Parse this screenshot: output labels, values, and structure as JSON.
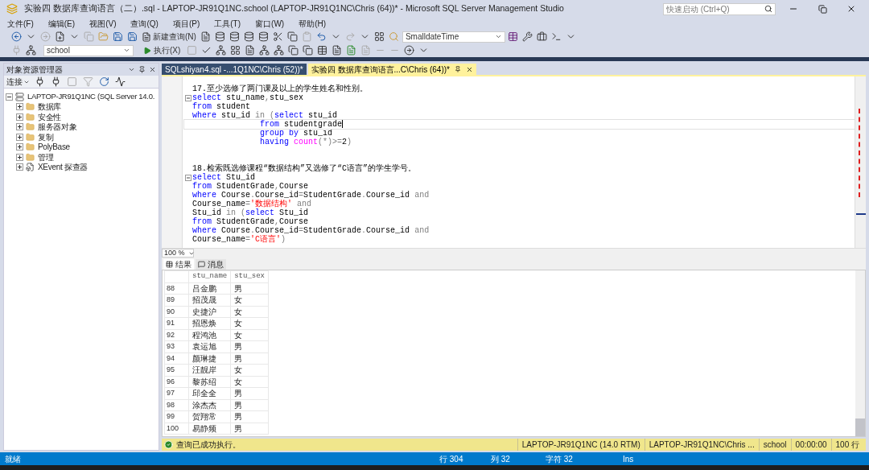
{
  "window": {
    "title": "实验四 数据库查询语言（二）.sql - LAPTOP-JR91Q1NC.school (LAPTOP-JR91Q1NC\\Chris (64))* - Microsoft SQL Server Management Studio",
    "quick_launch": {
      "placeholder": "快速启动 (Ctrl+Q)"
    }
  },
  "menu": [
    "文件(F)",
    "编辑(E)",
    "视图(V)",
    "查询(Q)",
    "项目(P)",
    "工具(T)",
    "窗口(W)",
    "帮助(H)"
  ],
  "toolbar": {
    "new_query": "新建查询(N)",
    "type_dropdown": "SmalldateTime",
    "database_dropdown": "school",
    "execute": "执行(X)"
  },
  "object_explorer": {
    "title": "对象资源管理器",
    "connect": "连接",
    "tree": [
      {
        "label": "LAPTOP-JR91Q1NC (SQL Server 14.0.",
        "kind": "server",
        "expanded": true,
        "children": [
          {
            "label": "数据库",
            "kind": "folder",
            "expanded": false
          },
          {
            "label": "安全性",
            "kind": "folder",
            "expanded": false
          },
          {
            "label": "服务器对象",
            "kind": "folder",
            "expanded": false
          },
          {
            "label": "复制",
            "kind": "folder",
            "expanded": false
          },
          {
            "label": "PolyBase",
            "kind": "folder",
            "expanded": false
          },
          {
            "label": "管理",
            "kind": "folder",
            "expanded": false
          },
          {
            "label": "XEvent 探查器",
            "kind": "xevent",
            "expanded": false
          }
        ]
      }
    ]
  },
  "editor_tabs": [
    {
      "label": "SQLshiyan4.sql -...1Q1NC\\Chris (52))*",
      "selected": false
    },
    {
      "label": "实验四  数据库查询语言...C\\Chris (64))*",
      "selected": true
    }
  ],
  "editor": {
    "zoom": "100 %",
    "lines": [
      {
        "fold": false,
        "current": false,
        "tokens": [
          {
            "t": "17.至少选修了两门课及以上的学生姓名和性别。",
            "kind": "text"
          }
        ]
      },
      {
        "fold": true,
        "current": false,
        "tokens": [
          {
            "t": "select",
            "kind": "kw"
          },
          {
            "t": " stu_name",
            "kind": "id"
          },
          {
            "t": ",",
            "kind": "op"
          },
          {
            "t": "stu_sex",
            "kind": "id"
          }
        ]
      },
      {
        "fold": false,
        "current": false,
        "tokens": [
          {
            "t": "from",
            "kind": "kw"
          },
          {
            "t": " student",
            "kind": "id"
          }
        ]
      },
      {
        "fold": false,
        "current": false,
        "tokens": [
          {
            "t": "where",
            "kind": "kw"
          },
          {
            "t": " stu_id ",
            "kind": "id"
          },
          {
            "t": "in (",
            "kind": "op"
          },
          {
            "t": "select",
            "kind": "kw"
          },
          {
            "t": " stu_id",
            "kind": "id"
          }
        ]
      },
      {
        "fold": false,
        "current": true,
        "tokens": [
          {
            "t": "              from",
            "kind": "kw"
          },
          {
            "t": " studentgrade",
            "kind": "id"
          }
        ]
      },
      {
        "fold": false,
        "current": false,
        "tokens": [
          {
            "t": "              group by",
            "kind": "kw"
          },
          {
            "t": " stu_id",
            "kind": "id"
          }
        ]
      },
      {
        "fold": false,
        "current": false,
        "tokens": [
          {
            "t": "              having",
            "kind": "kw"
          },
          {
            "t": " count",
            "kind": "fn"
          },
          {
            "t": "(*)>=",
            "kind": "op"
          },
          {
            "t": "2",
            "kind": "id"
          },
          {
            "t": ")",
            "kind": "op"
          }
        ]
      },
      {
        "fold": false,
        "current": false
      },
      {
        "fold": false,
        "current": false
      },
      {
        "fold": false,
        "current": false,
        "tokens": [
          {
            "t": "18.检索既选修课程“数据结构”又选修了“C语言”的学生学号。",
            "kind": "text"
          }
        ]
      },
      {
        "fold": true,
        "current": false,
        "tokens": [
          {
            "t": "select",
            "kind": "kw"
          },
          {
            "t": " Stu_id",
            "kind": "id"
          }
        ]
      },
      {
        "fold": false,
        "current": false,
        "tokens": [
          {
            "t": "from",
            "kind": "kw"
          },
          {
            "t": " StudentGrade",
            "kind": "id"
          },
          {
            "t": ",",
            "kind": "op"
          },
          {
            "t": "Course",
            "kind": "id"
          }
        ]
      },
      {
        "fold": false,
        "current": false,
        "tokens": [
          {
            "t": "where",
            "kind": "kw"
          },
          {
            "t": " Course",
            "kind": "id"
          },
          {
            "t": ".",
            "kind": "op"
          },
          {
            "t": "Course_id",
            "kind": "id"
          },
          {
            "t": "=",
            "kind": "op"
          },
          {
            "t": "StudentGrade",
            "kind": "id"
          },
          {
            "t": ".",
            "kind": "op"
          },
          {
            "t": "Course_id ",
            "kind": "id"
          },
          {
            "t": "and",
            "kind": "op"
          }
        ]
      },
      {
        "fold": false,
        "current": false,
        "tokens": [
          {
            "t": "Course_name",
            "kind": "id"
          },
          {
            "t": "=",
            "kind": "op"
          },
          {
            "t": "'数据结构'",
            "kind": "str"
          },
          {
            "t": " and",
            "kind": "op"
          }
        ]
      },
      {
        "fold": false,
        "current": false,
        "tokens": [
          {
            "t": "Stu_id ",
            "kind": "id"
          },
          {
            "t": "in (",
            "kind": "op"
          },
          {
            "t": "select",
            "kind": "kw"
          },
          {
            "t": " Stu_id",
            "kind": "id"
          }
        ]
      },
      {
        "fold": false,
        "current": false,
        "tokens": [
          {
            "t": "from",
            "kind": "kw"
          },
          {
            "t": " StudentGrade",
            "kind": "id"
          },
          {
            "t": ",",
            "kind": "op"
          },
          {
            "t": "Course",
            "kind": "id"
          }
        ]
      },
      {
        "fold": false,
        "current": false,
        "tokens": [
          {
            "t": "where",
            "kind": "kw"
          },
          {
            "t": " Course",
            "kind": "id"
          },
          {
            "t": ".",
            "kind": "op"
          },
          {
            "t": "Course_id",
            "kind": "id"
          },
          {
            "t": "=",
            "kind": "op"
          },
          {
            "t": "StudentGrade",
            "kind": "id"
          },
          {
            "t": ".",
            "kind": "op"
          },
          {
            "t": "Course_id ",
            "kind": "id"
          },
          {
            "t": "and",
            "kind": "op"
          }
        ]
      },
      {
        "fold": false,
        "current": false,
        "tokens": [
          {
            "t": "Course_name",
            "kind": "id"
          },
          {
            "t": "=",
            "kind": "op"
          },
          {
            "t": "'C语言'",
            "kind": "str"
          },
          {
            "t": ")",
            "kind": "op"
          }
        ]
      }
    ]
  },
  "result_tabs": [
    {
      "label": "结果",
      "kind": "grid",
      "selected": true
    },
    {
      "label": "消息",
      "kind": "messages",
      "selected": false
    }
  ],
  "results": {
    "columns": [
      "stu_name",
      "stu_sex"
    ],
    "rows": [
      {
        "n": "88",
        "cells": [
          "吕金鹏",
          "男"
        ]
      },
      {
        "n": "89",
        "cells": [
          "招茂晟",
          "女"
        ]
      },
      {
        "n": "90",
        "cells": [
          "史捷沪",
          "女"
        ]
      },
      {
        "n": "91",
        "cells": [
          "招恩焕",
          "女"
        ]
      },
      {
        "n": "92",
        "cells": [
          "程鸿池",
          "女"
        ]
      },
      {
        "n": "93",
        "cells": [
          "袁运旭",
          "男"
        ]
      },
      {
        "n": "94",
        "cells": [
          "颜琳捷",
          "男"
        ]
      },
      {
        "n": "95",
        "cells": [
          "汪靓岸",
          "女"
        ]
      },
      {
        "n": "96",
        "cells": [
          "黎苏绍",
          "女"
        ]
      },
      {
        "n": "97",
        "cells": [
          "邱全全",
          "男"
        ]
      },
      {
        "n": "98",
        "cells": [
          "涂杰杰",
          "男"
        ]
      },
      {
        "n": "99",
        "cells": [
          "贺翔常",
          "男"
        ]
      },
      {
        "n": "100",
        "cells": [
          "易静频",
          "男"
        ]
      }
    ]
  },
  "query_status": {
    "message": "查询已成功执行。",
    "segments": [
      "LAPTOP-JR91Q1NC (14.0 RTM)",
      "LAPTOP-JR91Q1NC\\Chris ...",
      "school",
      "00:00:00",
      "100 行"
    ]
  },
  "status_bar": [
    "就绪",
    "行 304",
    "列 32",
    "字符 32",
    "Ins"
  ]
}
